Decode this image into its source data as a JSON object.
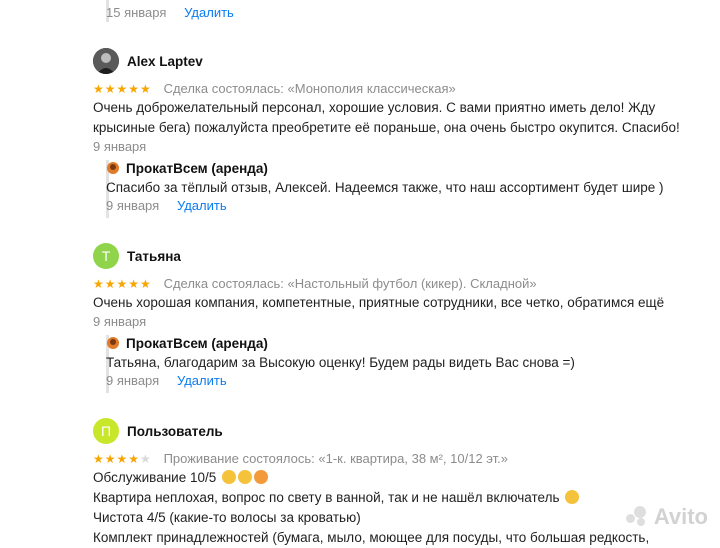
{
  "top_reply": {
    "date": "15 января",
    "delete": "Удалить"
  },
  "reviews": [
    {
      "author": "Alex Laptev",
      "stars": "★★★★★",
      "deal": "Сделка состоялась: «Монополия классическая»",
      "text": "Очень доброжелательный персонал, хорошие условия. С вами приятно иметь дело! Жду крысиные бега) пожалуйста преобретите её пораньше, она очень быстро окупится. Спасибо!",
      "date": "9 января",
      "reply": {
        "shop": "ПрокатВсем (аренда)",
        "text": "Спасибо за тёплый отзыв, Алексей. Надеемся также, что наш ассортимент будет шире )",
        "date": "9 января",
        "delete": "Удалить"
      }
    },
    {
      "author": "Татьяна",
      "avatar_letter": "Т",
      "avatar_color": "#8fd44a",
      "stars": "★★★★★",
      "deal": "Сделка состоялась: «Настольный футбол (кикер). Складной»",
      "text": "Очень хорошая компания, компетентные, приятные сотрудники, все четко, обратимся ещё",
      "date": "9 января",
      "reply": {
        "shop": "ПрокатВсем (аренда)",
        "text": "Татьяна, благодарим за Высокую оценку! Будем рады видеть Вас снова =)",
        "date": "9 января",
        "delete": "Удалить"
      }
    },
    {
      "author": "Пользователь",
      "avatar_letter": "П",
      "avatar_color": "#c8e62a",
      "stars": "★★★★",
      "deal": "Проживание состоялось: «1-к. квартира, 38 м², 10/12 эт.»",
      "lines": [
        "Обслуживание 10/5",
        "Квартира неплохая, вопрос по свету в ванной, так и не нашёл включатель",
        "Чистота 4/5 (какие-то волосы за кроватью)",
        "Комплект принадлежностей (бумага, мыло, моющее для посуды, что большая редкость,"
      ]
    }
  ],
  "watermark": "Avito",
  "colors": {
    "link": "#0a7cf0",
    "star": "#f7a600",
    "muted": "#8c8c8c"
  }
}
